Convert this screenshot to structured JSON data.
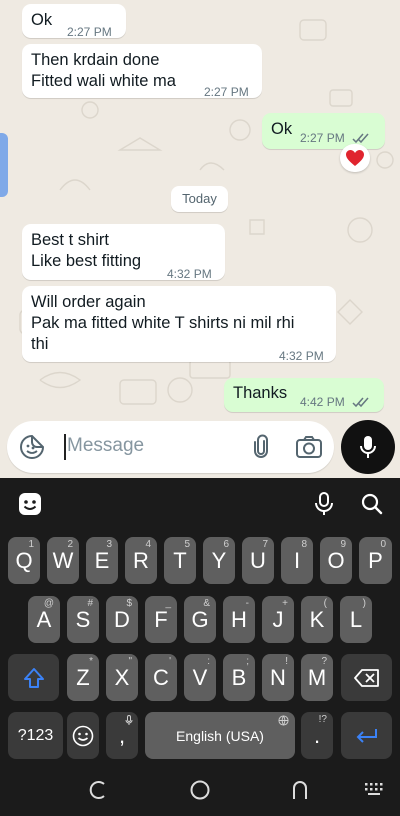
{
  "chat": {
    "messages": [
      {
        "dir": "in",
        "text": "Ok",
        "time": "2:27 PM"
      },
      {
        "dir": "in",
        "text": "Then krdain done\nFitted wali white ma",
        "time": "2:27 PM"
      },
      {
        "dir": "out",
        "text": "Ok",
        "time": "2:27 PM",
        "reaction": "red-heart"
      },
      {
        "dir": "in",
        "text": "Best t shirt\nLike best fitting",
        "time": "4:32 PM"
      },
      {
        "dir": "in",
        "text": "Will order again\nPak ma fitted white T shirts ni mil rhi\nthi",
        "time": "4:32 PM"
      },
      {
        "dir": "out",
        "text": "Thanks",
        "time": "4:42 PM"
      }
    ],
    "date_chip": "Today"
  },
  "composer": {
    "placeholder": "Message"
  },
  "keyboard": {
    "row1": [
      {
        "label": "Q",
        "hint": "1"
      },
      {
        "label": "W",
        "hint": "2"
      },
      {
        "label": "E",
        "hint": "3"
      },
      {
        "label": "R",
        "hint": "4"
      },
      {
        "label": "T",
        "hint": "5"
      },
      {
        "label": "Y",
        "hint": "6"
      },
      {
        "label": "U",
        "hint": "7"
      },
      {
        "label": "I",
        "hint": "8"
      },
      {
        "label": "O",
        "hint": "9"
      },
      {
        "label": "P",
        "hint": "0"
      }
    ],
    "row2": [
      {
        "label": "A",
        "hint": "@"
      },
      {
        "label": "S",
        "hint": "#"
      },
      {
        "label": "D",
        "hint": "$"
      },
      {
        "label": "F",
        "hint": "_"
      },
      {
        "label": "G",
        "hint": "&"
      },
      {
        "label": "H",
        "hint": "-"
      },
      {
        "label": "J",
        "hint": "+"
      },
      {
        "label": "K",
        "hint": "("
      },
      {
        "label": "L",
        "hint": ")"
      }
    ],
    "row3": [
      {
        "label": "Z",
        "hint": "*"
      },
      {
        "label": "X",
        "hint": "\""
      },
      {
        "label": "C",
        "hint": "'"
      },
      {
        "label": "V",
        "hint": ":"
      },
      {
        "label": "B",
        "hint": ";"
      },
      {
        "label": "N",
        "hint": "!"
      },
      {
        "label": "M",
        "hint": "?"
      }
    ],
    "symbols_key": "?123",
    "comma_key": ",",
    "space_label": "English (USA)",
    "period_key": ".",
    "period_hint": "!?"
  }
}
